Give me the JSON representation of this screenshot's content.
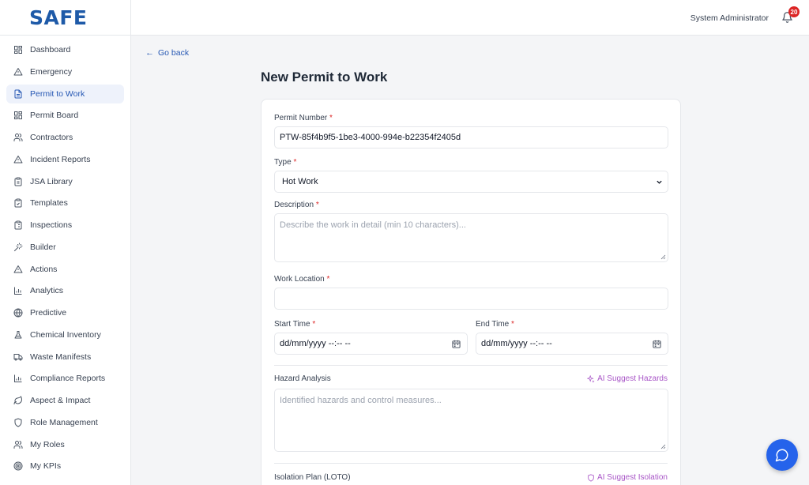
{
  "app": {
    "logo": "SAFE"
  },
  "sidebar": {
    "items": [
      {
        "label": "Dashboard",
        "icon": "grid-icon"
      },
      {
        "label": "Emergency",
        "icon": "alert-triangle-icon"
      },
      {
        "label": "Permit to Work",
        "icon": "file-icon",
        "active": true
      },
      {
        "label": "Permit Board",
        "icon": "grid-icon"
      },
      {
        "label": "Contractors",
        "icon": "users-icon"
      },
      {
        "label": "Incident Reports",
        "icon": "alert-triangle-icon"
      },
      {
        "label": "JSA Library",
        "icon": "clipboard-icon"
      },
      {
        "label": "Templates",
        "icon": "clipboard-check-icon"
      },
      {
        "label": "Inspections",
        "icon": "clipboard-list-icon"
      },
      {
        "label": "Builder",
        "icon": "wand-icon"
      },
      {
        "label": "Actions",
        "icon": "alert-triangle-icon"
      },
      {
        "label": "Analytics",
        "icon": "bar-chart-icon"
      },
      {
        "label": "Predictive",
        "icon": "globe-icon"
      },
      {
        "label": "Chemical Inventory",
        "icon": "flask-icon"
      },
      {
        "label": "Waste Manifests",
        "icon": "truck-icon"
      },
      {
        "label": "Compliance Reports",
        "icon": "bar-chart-icon"
      },
      {
        "label": "Aspect & Impact",
        "icon": "leaf-icon"
      },
      {
        "label": "Role Management",
        "icon": "shield-icon"
      },
      {
        "label": "My Roles",
        "icon": "users-icon"
      },
      {
        "label": "My KPIs",
        "icon": "target-icon"
      }
    ]
  },
  "header": {
    "user_name": "System Administrator",
    "notification_count": "20"
  },
  "main": {
    "go_back": "Go back",
    "title": "New Permit to Work",
    "form": {
      "permit_number": {
        "label": "Permit Number",
        "required": "*",
        "value": "PTW-85f4b9f5-1be3-4000-994e-b22354f2405d"
      },
      "type": {
        "label": "Type",
        "required": "*",
        "value": "Hot Work"
      },
      "description": {
        "label": "Description",
        "required": "*",
        "placeholder": "Describe the work in detail (min 10 characters)..."
      },
      "work_location": {
        "label": "Work Location",
        "required": "*",
        "value": ""
      },
      "start_time": {
        "label": "Start Time",
        "required": "*",
        "value": "dd/mm/yyyy --:-- --"
      },
      "end_time": {
        "label": "End Time",
        "required": "*",
        "value": "dd/mm/yyyy --:-- --"
      },
      "hazard_analysis": {
        "label": "Hazard Analysis",
        "ai_button": "AI Suggest Hazards",
        "placeholder": "Identified hazards and control measures..."
      },
      "isolation_plan": {
        "label": "Isolation Plan (LOTO)",
        "ai_button": "AI Suggest Isolation"
      }
    }
  },
  "colors": {
    "accent": "#2557b3",
    "ai_purple": "#a855c7",
    "required": "#dc2626",
    "badge": "#dc2626",
    "chat_button": "#2563eb"
  }
}
